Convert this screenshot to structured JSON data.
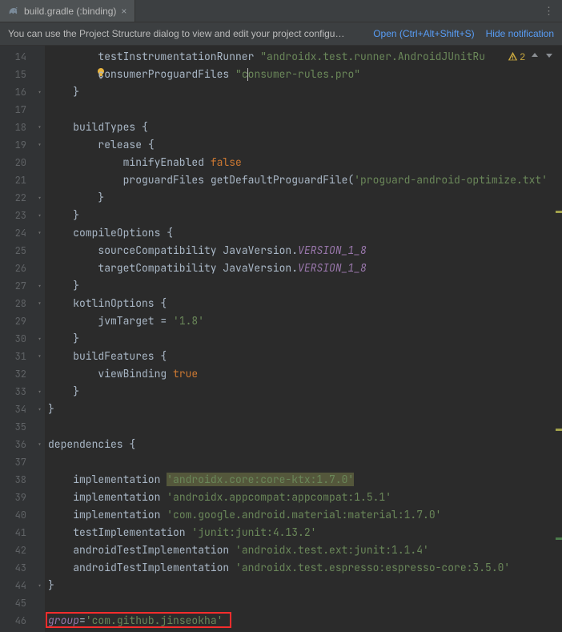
{
  "tab": {
    "filename": "build.gradle (:binding)"
  },
  "notification": {
    "message": "You can use the Project Structure dialog to view and edit your project configu…",
    "open": "Open",
    "shortcut": "(Ctrl+Alt+Shift+S)",
    "hide": "Hide notification"
  },
  "status": {
    "warn_count": "2"
  },
  "lines": {
    "start": 14,
    "end": 46
  },
  "code": {
    "l14": {
      "indent": "        ",
      "method": "testInstrumentationRunner",
      "sp": " ",
      "str": "\"androidx.test.runner.AndroidJUnitRu"
    },
    "l15": {
      "indent": "        ",
      "method": "consumerProguardFiles",
      "sp": " ",
      "str_a": "\"c",
      "str_b": "onsumer-rules.pro\""
    },
    "l16": {
      "indent": "    ",
      "brace": "}"
    },
    "l17": {
      "text": ""
    },
    "l18": {
      "indent": "    ",
      "id": "buildTypes",
      "sp": " ",
      "brace": "{"
    },
    "l19": {
      "indent": "        ",
      "id": "release",
      "sp": " ",
      "brace": "{"
    },
    "l20": {
      "indent": "            ",
      "id": "minifyEnabled",
      "sp": " ",
      "lit": "false"
    },
    "l21": {
      "indent": "            ",
      "id": "proguardFiles",
      "sp": " ",
      "call": "getDefaultProguardFile(",
      "str": "'proguard-android-optimize.txt'"
    },
    "l22": {
      "indent": "        ",
      "brace": "}"
    },
    "l23": {
      "indent": "    ",
      "brace": "}"
    },
    "l24": {
      "indent": "    ",
      "id": "compileOptions",
      "sp": " ",
      "brace": "{"
    },
    "l25": {
      "indent": "        ",
      "id": "sourceCompatibility",
      "sp": " ",
      "cls": "JavaVersion",
      "dot": ".",
      "const": "VERSION_1_8"
    },
    "l26": {
      "indent": "        ",
      "id": "targetCompatibility",
      "sp": " ",
      "cls": "JavaVersion",
      "dot": ".",
      "const": "VERSION_1_8"
    },
    "l27": {
      "indent": "    ",
      "brace": "}"
    },
    "l28": {
      "indent": "    ",
      "id": "kotlinOptions",
      "sp": " ",
      "brace": "{"
    },
    "l29": {
      "indent": "        ",
      "id": "jvmTarget",
      "eq": " = ",
      "str": "'1.8'"
    },
    "l30": {
      "indent": "    ",
      "brace": "}"
    },
    "l31": {
      "indent": "    ",
      "id": "buildFeatures",
      "sp": " ",
      "brace": "{"
    },
    "l32": {
      "indent": "        ",
      "id": "viewBinding",
      "sp": " ",
      "lit": "true"
    },
    "l33": {
      "indent": "    ",
      "brace": "}"
    },
    "l34": {
      "brace": "}"
    },
    "l35": {
      "text": ""
    },
    "l36": {
      "id": "dependencies",
      "sp": " ",
      "brace": "{"
    },
    "l37": {
      "text": ""
    },
    "l38": {
      "indent": "    ",
      "id": "implementation",
      "sp": " ",
      "str": "'androidx.core:core-ktx:1.7.0'"
    },
    "l39": {
      "indent": "    ",
      "id": "implementation",
      "sp": " ",
      "str": "'androidx.appcompat:appcompat:1.5.1'"
    },
    "l40": {
      "indent": "    ",
      "id": "implementation",
      "sp": " ",
      "str": "'com.google.android.material:material:1.7.0'"
    },
    "l41": {
      "indent": "    ",
      "id": "testImplementation",
      "sp": " ",
      "str": "'junit:junit:4.13.2'"
    },
    "l42": {
      "indent": "    ",
      "id": "androidTestImplementation",
      "sp": " ",
      "str": "'androidx.test.ext:junit:1.1.4'"
    },
    "l43": {
      "indent": "    ",
      "id": "androidTestImplementation",
      "sp": " ",
      "str": "'androidx.test.espresso:espresso-core:3.5.0'"
    },
    "l44": {
      "brace": "}"
    },
    "l45": {
      "text": ""
    },
    "l46": {
      "id": "group",
      "eq": "=",
      "str": "'com.github.jinseokha'"
    }
  }
}
